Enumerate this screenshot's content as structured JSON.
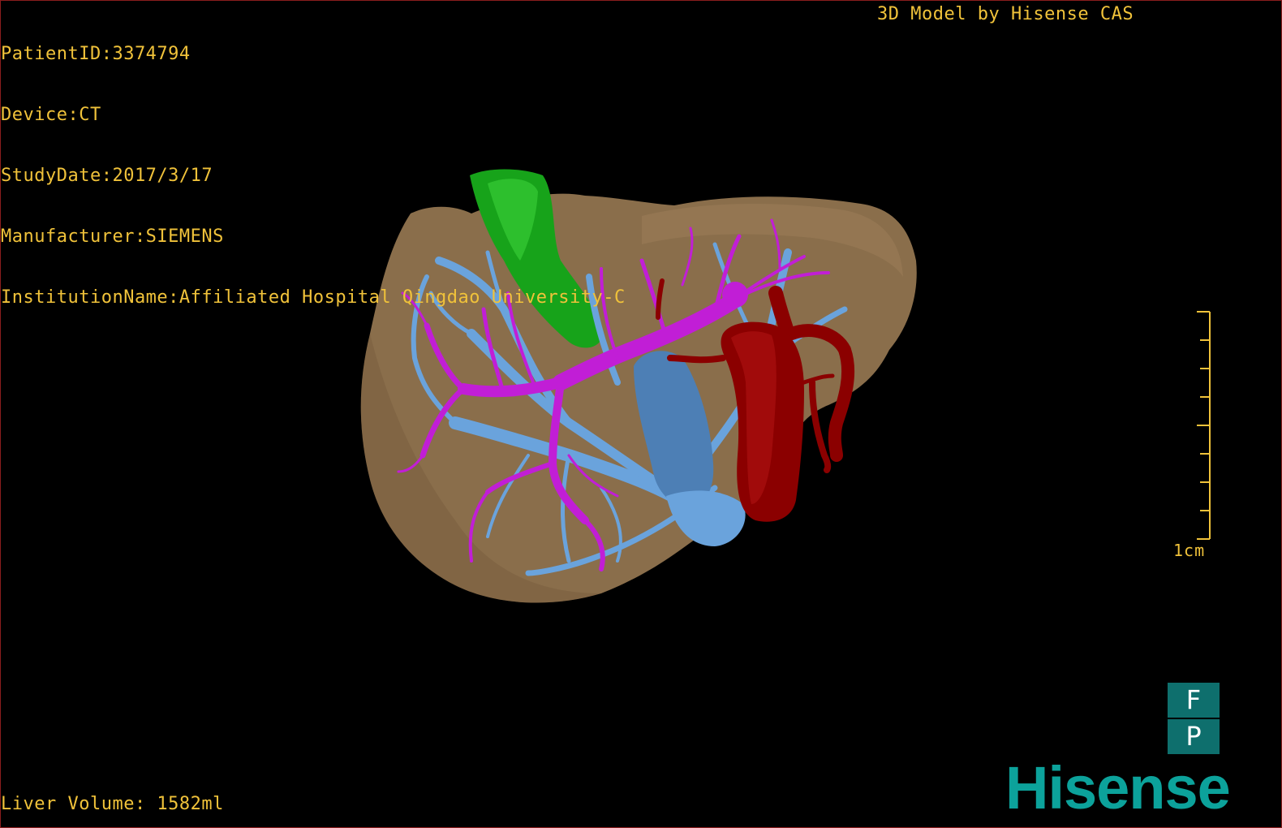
{
  "header_info": {
    "patient_id": "PatientID:3374794",
    "device": "Device:CT",
    "study_date": "StudyDate:2017/3/17",
    "manufacturer": "Manufacturer:SIEMENS",
    "institution": "InstitutionName:Affiliated Hospital Qingdao University-C"
  },
  "brand_caption": "3D Model by Hisense CAS",
  "footer": {
    "liver_volume": "Liver Volume: 1582ml"
  },
  "scale_bar": {
    "label": "1cm"
  },
  "orientation": {
    "top": "F",
    "bottom": "P"
  },
  "logo_text": "Hisense",
  "colors": {
    "overlay_text": "#f0c23a",
    "liver": "#8a6e4b",
    "gallbladder": "#17a31a",
    "portal_vein": "#c11ed6",
    "hepatic_vein": "#6aa3dc",
    "vena_cava": "#4d7fb5",
    "artery": "#8b0000",
    "brand": "#0ca29b",
    "orientation_box": "#0e6f6d"
  }
}
